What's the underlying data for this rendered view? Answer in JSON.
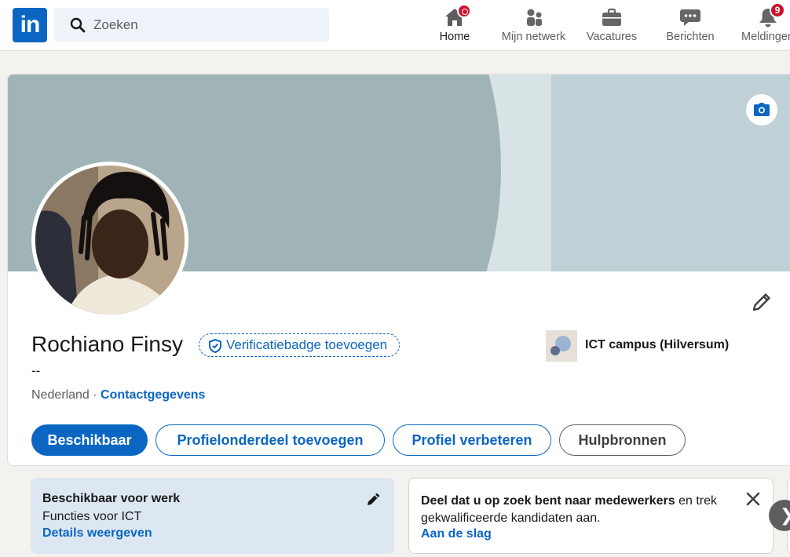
{
  "nav": {
    "logo_text": "in",
    "search_placeholder": "Zoeken",
    "items": [
      {
        "label": "Home"
      },
      {
        "label": "Mijn netwerk"
      },
      {
        "label": "Vacatures"
      },
      {
        "label": "Berichten"
      },
      {
        "label": "Meldingen"
      }
    ],
    "notifications_count": "9"
  },
  "profile": {
    "name": "Rochiano Finsy",
    "verify_label": "Verificatiebadge toevoegen",
    "headline": "--",
    "location": "Nederland",
    "separator": " · ",
    "contact_label": "Contactgegevens",
    "organization": "ICT campus (Hilversum)"
  },
  "actions": {
    "available": "Beschikbaar",
    "add_section": "Profielonderdeel toevoegen",
    "improve": "Profiel verbeteren",
    "resources": "Hulpbronnen"
  },
  "open_to_work": {
    "title": "Beschikbaar voor werk",
    "subtitle": "Functies voor ICT",
    "link": "Details weergeven"
  },
  "hiring": {
    "bold": "Deel dat u op zoek bent naar medewerkers",
    "rest": " en trek gekwalificeerde kandidaten aan.",
    "cta": "Aan de slag"
  },
  "colors": {
    "brand": "#0a66c2",
    "badge": "#cb112d",
    "banner_dark": "#a0b4b7",
    "banner_light": "#bfd1d6"
  }
}
